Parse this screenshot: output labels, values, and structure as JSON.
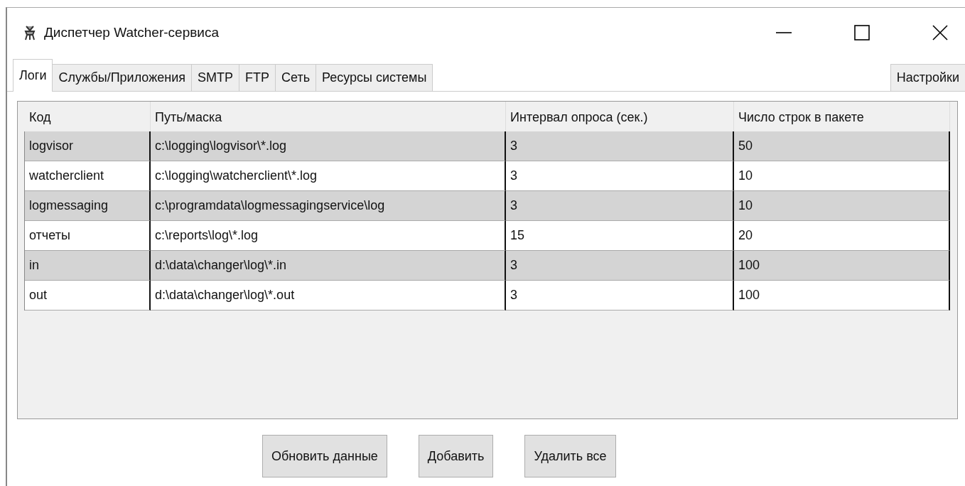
{
  "window": {
    "title": "Диспетчер Watcher-сервиса"
  },
  "tabs": [
    {
      "label": "Логи",
      "selected": true
    },
    {
      "label": "Службы/Приложения",
      "selected": false
    },
    {
      "label": "SMTP",
      "selected": false
    },
    {
      "label": "FTP",
      "selected": false
    },
    {
      "label": "Сеть",
      "selected": false
    },
    {
      "label": "Ресурсы системы",
      "selected": false
    }
  ],
  "settings_tab": {
    "label": "Настройки",
    "selected": false
  },
  "table": {
    "columns": [
      "Код",
      "Путь/маска",
      "Интервал опроса (сек.)",
      "Число строк в пакете"
    ],
    "rows": [
      [
        "logvisor",
        "c:\\logging\\logvisor\\*.log",
        "3",
        "50"
      ],
      [
        "watcherclient",
        "c:\\logging\\watcherclient\\*.log",
        "3",
        "10"
      ],
      [
        "logmessaging",
        "c:\\programdata\\logmessagingservice\\log",
        "3",
        "10"
      ],
      [
        "отчеты",
        "c:\\reports\\log\\*.log",
        "15",
        "20"
      ],
      [
        "in",
        "d:\\data\\changer\\log\\*.in",
        "3",
        "100"
      ],
      [
        "out",
        "d:\\data\\changer\\log\\*.out",
        "3",
        "100"
      ]
    ]
  },
  "buttons": [
    "Обновить данные",
    "Добавить",
    "Удалить все"
  ]
}
